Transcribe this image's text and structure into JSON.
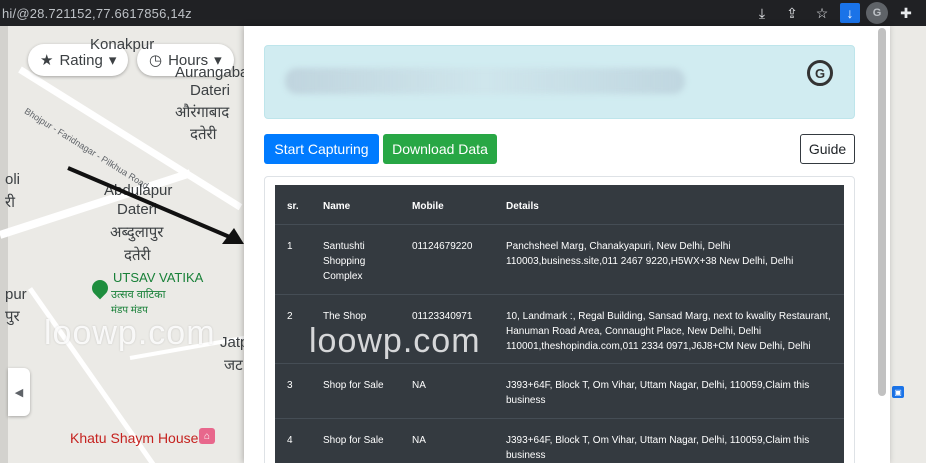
{
  "browser": {
    "url": "hi/@28.721152,77.6617856,14z",
    "icons": [
      "download-tray-icon",
      "share-icon",
      "star-icon",
      "download-icon",
      "profile-icon",
      "extensions-icon"
    ]
  },
  "map": {
    "chips": [
      {
        "label": "Rating",
        "icon": "star-icon"
      },
      {
        "label": "Hours",
        "icon": "clock-icon"
      }
    ],
    "labels": {
      "konakpur": "Konakpur",
      "aurangabad": "Aurangabad",
      "dateri1": "Dateri",
      "aurangabad_hi": "औरंगाबाद",
      "dateri_hi1": "दतेरी",
      "road": "Bhojpur - Faridnagar - Pilkhua Road",
      "abdulapur": "Abdulapur",
      "dateri2": "Dateri",
      "abdulapur_hi": "अब्दुलापुर",
      "dateri_hi2": "दतेरी",
      "utsav": "UTSAV VATIKA",
      "utsav_hi1": "उत्सव वाटिका",
      "utsav_hi2": "मंडप मंडप",
      "left1": "oli",
      "left2": "री",
      "left3": "pur",
      "left4": "पुर",
      "jatp": "Jatp",
      "jatp_hi": "जट",
      "khatu": "Khatu Shaym House"
    },
    "watermark": "loowp.com"
  },
  "popup": {
    "watermark": "loowp.com",
    "buttons": {
      "start": "Start Capturing",
      "download": "Download Data",
      "guide": "Guide"
    },
    "table": {
      "headers": [
        "sr.",
        "Name",
        "Mobile",
        "Details"
      ],
      "rows": [
        {
          "sr": "1",
          "name": "Santushti Shopping Complex",
          "mobile": "01124679220",
          "details": "Panchsheel Marg, Chanakyapuri, New Delhi, Delhi 110003,business.site,011 2467 9220,H5WX+38 New Delhi, Delhi"
        },
        {
          "sr": "2",
          "name": "The Shop",
          "mobile": "01123340971",
          "details": "10, Landmark :, Regal Building, Sansad Marg, next to kwality Restaurant, Hanuman Road Area, Connaught Place, New Delhi, Delhi 110001,theshopindia.com,011 2334 0971,J6J8+CM New Delhi, Delhi"
        },
        {
          "sr": "3",
          "name": "Shop for Sale",
          "mobile": "NA",
          "details": "J393+64F, Block T, Om Vihar, Uttam Nagar, Delhi, 110059,Claim this business"
        },
        {
          "sr": "4",
          "name": "Shop for Sale",
          "mobile": "NA",
          "details": "J393+64F, Block T, Om Vihar, Uttam Nagar, Delhi, 110059,Claim this business"
        }
      ]
    }
  }
}
